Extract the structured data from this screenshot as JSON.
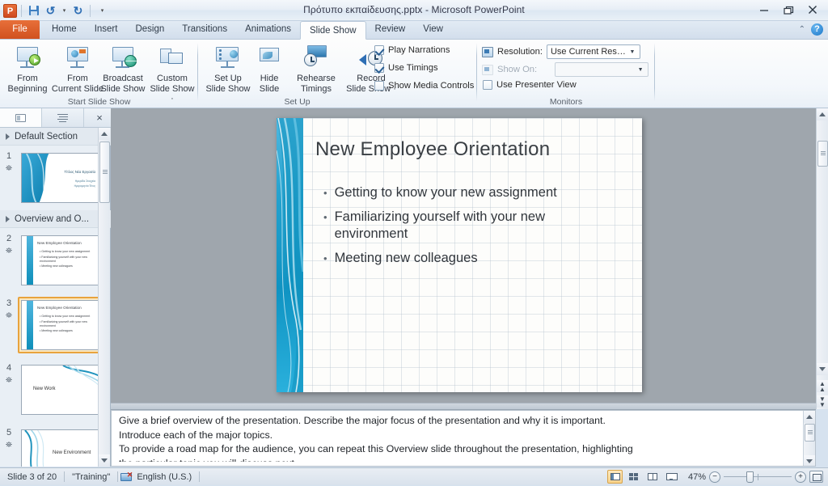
{
  "window": {
    "title": "Πρότυπο εκπαίδευσης.pptx  -  Microsoft PowerPoint",
    "app_logo": "P",
    "quick_access": [
      {
        "name": "save-icon",
        "tooltip": "Save"
      },
      {
        "name": "undo-icon",
        "tooltip": "Undo"
      },
      {
        "name": "redo-icon",
        "tooltip": "Redo"
      },
      {
        "name": "customize-qat-icon",
        "tooltip": "Customize Quick Access Toolbar"
      }
    ],
    "controls": {
      "minimize": "minimize-icon",
      "restore": "restore-icon",
      "close": "close-icon"
    },
    "ribbon_collapse": "minimize-ribbon-icon",
    "help": "?"
  },
  "tabs": [
    {
      "label": "File",
      "active": false,
      "file": true
    },
    {
      "label": "Home",
      "active": false
    },
    {
      "label": "Insert",
      "active": false
    },
    {
      "label": "Design",
      "active": false
    },
    {
      "label": "Transitions",
      "active": false
    },
    {
      "label": "Animations",
      "active": false
    },
    {
      "label": "Slide Show",
      "active": true
    },
    {
      "label": "Review",
      "active": false
    },
    {
      "label": "View",
      "active": false
    }
  ],
  "ribbon": {
    "groups": [
      {
        "name": "Start Slide Show",
        "buttons": [
          {
            "line1": "From",
            "line2": "Beginning"
          },
          {
            "line1": "From",
            "line2": "Current Slide"
          },
          {
            "line1": "Broadcast",
            "line2": "Slide Show"
          },
          {
            "line1": "Custom",
            "line2": "Slide Show ·"
          }
        ]
      },
      {
        "name": "Set Up",
        "buttons": [
          {
            "line1": "Set Up",
            "line2": "Slide Show"
          },
          {
            "line1": "Hide",
            "line2": "Slide"
          },
          {
            "line1": "Rehearse",
            "line2": "Timings"
          },
          {
            "line1": "Record",
            "line2": "Slide Show ·"
          }
        ],
        "checkboxes": [
          {
            "label": "Play Narrations",
            "checked": true,
            "enabled": true
          },
          {
            "label": "Use Timings",
            "checked": true,
            "enabled": true
          },
          {
            "label": "Show Media Controls",
            "checked": false,
            "enabled": true
          }
        ]
      },
      {
        "name": "Monitors",
        "fields": [
          {
            "label": "Resolution:",
            "value": "Use Current Resolut...",
            "enabled": true
          },
          {
            "label": "Show On:",
            "value": "",
            "enabled": false
          }
        ],
        "checkboxes": [
          {
            "label": "Use Presenter View",
            "checked": false,
            "enabled": true
          }
        ]
      }
    ]
  },
  "slide_panel": {
    "tabs": [
      {
        "name": "slides-tab",
        "selected": true
      },
      {
        "name": "outline-tab",
        "selected": false
      }
    ],
    "close": "×",
    "sections": [
      {
        "title": "Default Section",
        "slides": [
          {
            "number": "1",
            "kind": "title",
            "title": "Τίτλος Νέα Εργασία",
            "sub1": "Ημερίδα Στοιχεία",
            "sub2": "Ημερομηνία Έτος",
            "selected": false
          }
        ]
      },
      {
        "title": "Overview and O...",
        "slides": [
          {
            "number": "2",
            "kind": "content",
            "title": "New Employee Orientation",
            "bullets": [
              "Getting to know your new assignment",
              "Familiarizing yourself with your new environment",
              "Meeting new colleagues"
            ],
            "selected": false
          },
          {
            "number": "3",
            "kind": "content",
            "title": "New Employee Orientation",
            "bullets": [
              "Getting to know your new assignment",
              "Familiarizing yourself with your new environment",
              "Meeting new colleagues"
            ],
            "selected": true
          },
          {
            "number": "4",
            "kind": "swoosh",
            "title": "New Work",
            "selected": false
          },
          {
            "number": "5",
            "kind": "swoosh2",
            "title": "New Environment",
            "selected": false
          }
        ]
      }
    ]
  },
  "slide": {
    "title": "New Employee Orientation",
    "bullets": [
      "Getting to know your new assignment",
      "Familiarizing yourself with your new",
      "environment",
      "Meeting new colleagues"
    ],
    "bullet_items": [
      {
        "text": "Getting to know your new assignment",
        "bulleted": true
      },
      {
        "text": "Familiarizing yourself with your new environment",
        "bulleted": true
      },
      {
        "text": "Meeting new colleagues",
        "bulleted": true
      }
    ],
    "accent_color": "#1f9fcb"
  },
  "notes": {
    "lines": [
      "Give a brief overview of the presentation. Describe the major focus of the presentation and why it is important.",
      "Introduce each of the major topics.",
      "To provide a road map for the audience, you can repeat this Overview slide throughout the presentation, highlighting",
      "the particular topic you will discuss next."
    ]
  },
  "status_bar": {
    "slide_count": "Slide 3 of 20",
    "theme": "\"Training\"",
    "language": "English (U.S.)",
    "spell_icon": "spell-check-icon",
    "views": [
      {
        "name": "normal-view-button",
        "selected": true
      },
      {
        "name": "slide-sorter-view-button",
        "selected": false
      },
      {
        "name": "reading-view-button",
        "selected": false
      },
      {
        "name": "slide-show-view-button",
        "selected": false
      }
    ],
    "zoom": "47%",
    "zoom_out": "−",
    "zoom_in": "+",
    "fit_button": "fit-slide-to-window-icon"
  },
  "scrollbars": {
    "previous_slide": "previous-slide-button",
    "next_slide": "next-slide-button"
  }
}
